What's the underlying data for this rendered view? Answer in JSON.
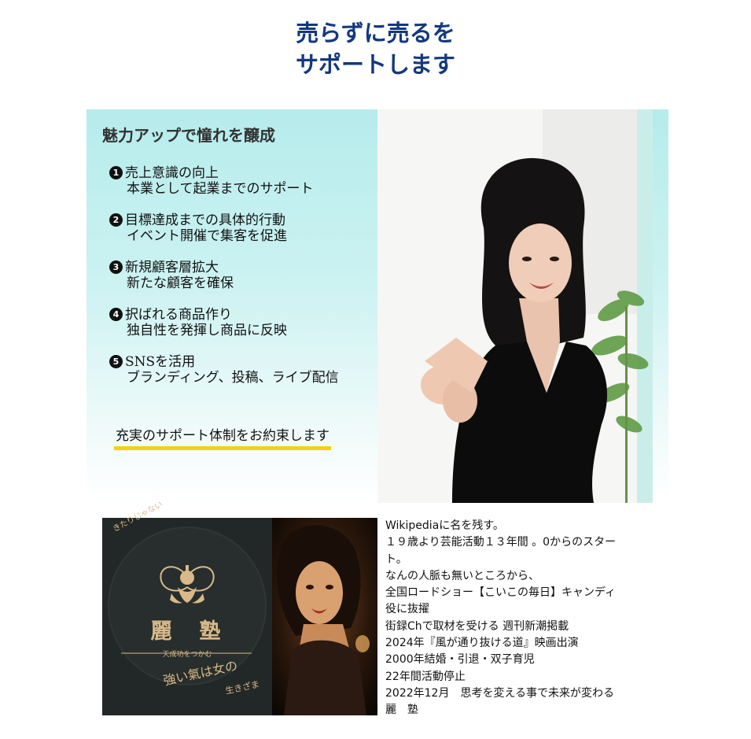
{
  "headline": {
    "line1": "売らずに売るを",
    "line2": "サポートします"
  },
  "panel": {
    "title": "魅力アップで憧れを醸成",
    "points": [
      {
        "num": "1",
        "title": "売上意識の向上",
        "desc": "本業として起業までのサポート"
      },
      {
        "num": "2",
        "title": "目標達成までの具体的行動",
        "desc": "イベント開催で集客を促進"
      },
      {
        "num": "3",
        "title": "新規顧客層拡大",
        "desc": "新たな顧客を確保"
      },
      {
        "num": "4",
        "title": "択ばれる商品作り",
        "desc": "独自性を発揮し商品に反映"
      },
      {
        "num": "5",
        "title": "SNSを活用",
        "desc": "ブランディング、投稿、ライブ配信"
      }
    ],
    "promise": "充実のサポート体制をお約束します",
    "underline_color": "#f5d20b"
  },
  "logo": {
    "arc_text": "きたりじゃない",
    "name": "麗　塾",
    "subtitle": "天成功をつかむ",
    "tagline1": "強い氣は女の",
    "tagline2": "生きざま"
  },
  "bio": {
    "lines": [
      "Wikipediaに名を残す。",
      "１９歳より芸能活動１３年間 。0からのスター",
      "ト。",
      "なんの人脈も無いところから、",
      "全国ロードショー【こいこの毎日】キャンディ",
      "役に抜擢",
      "街録Chで取材を受ける 週刊新潮掲載",
      "2024年『風が通り抜ける道』映画出演",
      "2000年結婚・引退・双子育児",
      "22年間活動停止",
      "2022年12月　思考を変える事で未来が変わる",
      "麗　塾"
    ]
  },
  "colors": {
    "headline": "#14387f",
    "panel_top": "#b6ecec",
    "logo_bg": "#222827",
    "logo_gold": "#d9b98a"
  }
}
